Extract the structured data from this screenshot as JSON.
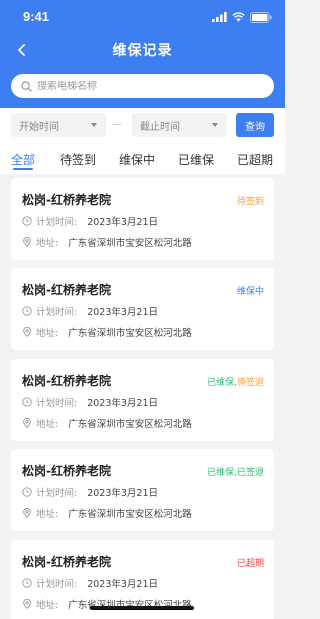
{
  "status_bar": {
    "time": "9:41"
  },
  "nav": {
    "title": "维保记录"
  },
  "search": {
    "placeholder": "搜索电梯名称"
  },
  "filter": {
    "start_placeholder": "开始时间",
    "end_placeholder": "截止时间",
    "query_label": "查询"
  },
  "tabs": [
    {
      "label": "全部",
      "active": true
    },
    {
      "label": "待签到"
    },
    {
      "label": "维保中"
    },
    {
      "label": "已维保"
    },
    {
      "label": "已超期"
    }
  ],
  "records": [
    {
      "name": "松岗-红桥养老院",
      "status": [
        {
          "text": "待签到",
          "color": "#f5a03c"
        }
      ],
      "plan_label": "计划时间:",
      "plan_date": "2023年3月21日",
      "address_label": "地址:",
      "address": "广东省深圳市宝安区松河北路"
    },
    {
      "name": "松岗-红桥养老院",
      "status": [
        {
          "text": "维保中",
          "color": "#3d7ef0"
        }
      ],
      "plan_label": "计划时间:",
      "plan_date": "2023年3月21日",
      "address_label": "地址:",
      "address": "广东省深圳市宝安区松河北路"
    },
    {
      "name": "松岗-红桥养老院",
      "status": [
        {
          "text": "已维保,",
          "color": "#2dbd6e"
        },
        {
          "text": "待签退",
          "color": "#f5a03c"
        }
      ],
      "plan_label": "计划时间:",
      "plan_date": "2023年3月21日",
      "address_label": "地址:",
      "address": "广东省深圳市宝安区松河北路"
    },
    {
      "name": "松岗-红桥养老院",
      "status": [
        {
          "text": "已维保,",
          "color": "#2dbd6e"
        },
        {
          "text": "已签退",
          "color": "#2dbd6e"
        }
      ],
      "plan_label": "计划时间:",
      "plan_date": "2023年3月21日",
      "address_label": "地址:",
      "address": "广东省深圳市宝安区松河北路"
    },
    {
      "name": "松岗-红桥养老院",
      "status": [
        {
          "text": "已超期",
          "color": "#f04646"
        }
      ],
      "plan_label": "计划时间:",
      "plan_date": "2023年3月21日",
      "address_label": "地址:",
      "address": "广东省深圳市宝安区松河北路"
    }
  ],
  "colors": {
    "primary": "#3d7ef0",
    "orange": "#f5a03c",
    "green": "#2dbd6e",
    "red": "#f04646"
  },
  "icons": {
    "back": "chevron-left-icon",
    "search": "search-icon",
    "plan": "clock-icon",
    "address": "location-pin-icon"
  }
}
